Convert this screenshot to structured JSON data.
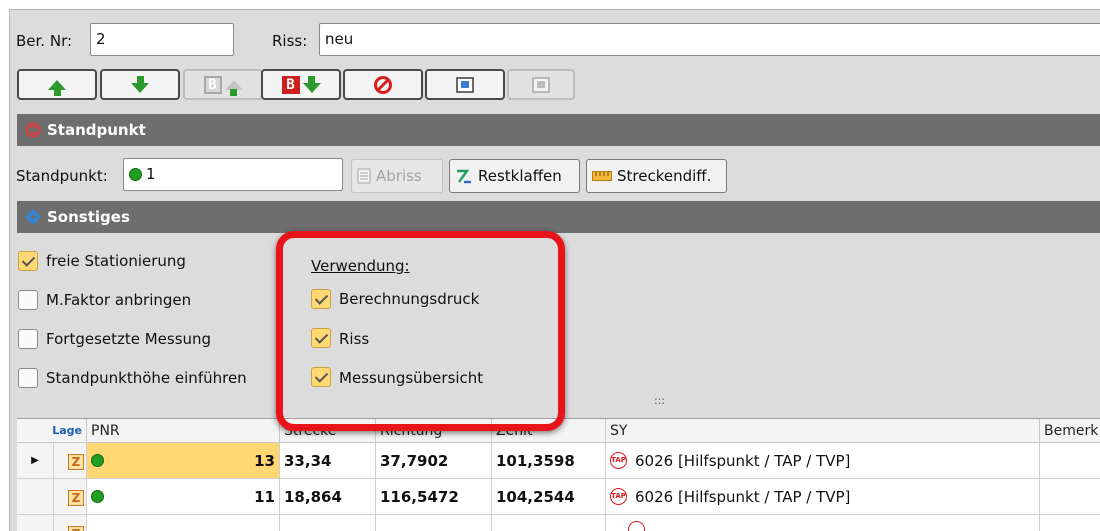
{
  "header": {
    "ber_nr_label": "Ber. Nr:",
    "ber_nr_value": "2",
    "riss_label": "Riss:",
    "riss_value": "neu"
  },
  "sections": {
    "standpunkt_title": "Standpunkt",
    "sonstiges_title": "Sonstiges"
  },
  "standpunkt": {
    "label": "Standpunkt:",
    "value": "1",
    "abriss_label": "Abriss",
    "restklaffen_label": "Restklaffen",
    "streckendiff_label": "Streckendiff."
  },
  "options": [
    {
      "label": "freie Stationierung",
      "checked": true
    },
    {
      "label": "M.Faktor anbringen",
      "checked": false
    },
    {
      "label": "Fortgesetzte Messung",
      "checked": false
    },
    {
      "label": "Standpunkthöhe einführen",
      "checked": false
    }
  ],
  "verwendung": {
    "title": "Verwendung:",
    "items": [
      {
        "label": "Berechnungsdruck",
        "checked": true
      },
      {
        "label": "Riss",
        "checked": true
      },
      {
        "label": "Messungsübersicht",
        "checked": true
      }
    ]
  },
  "splitter": ":::",
  "table": {
    "columns": [
      "Lage",
      "PNR",
      "Strecke",
      "Richtung",
      "Zenit",
      "SY",
      "Bemerk"
    ],
    "rows": [
      {
        "pnr": "13",
        "strecke": "33,34",
        "richtung": "37,7902",
        "zenit": "101,3598",
        "sy": "6026 [Hilfspunkt / TAP / TVP]"
      },
      {
        "pnr": "11",
        "strecke": "18,864",
        "richtung": "116,5472",
        "zenit": "104,2544",
        "sy": "6026 [Hilfspunkt / TAP / TVP]"
      }
    ]
  },
  "colors": {
    "accent_red": "#e8141a",
    "status_green": "#1f9e1f",
    "section_bg": "#6e6e6e"
  }
}
